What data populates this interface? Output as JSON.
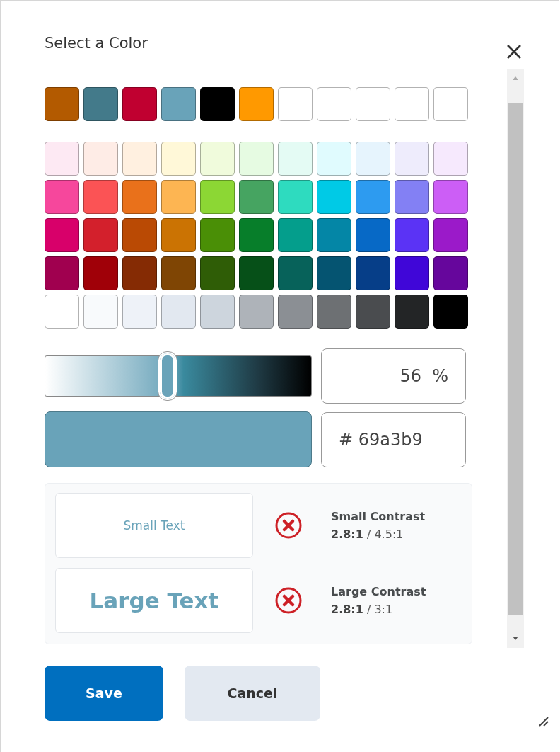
{
  "dialog": {
    "title": "Select a Color"
  },
  "custom_swatches": [
    {
      "color": "#b35a00"
    },
    {
      "color": "#437a8a"
    },
    {
      "color": "#c00030"
    },
    {
      "color": "#69a3b9"
    },
    {
      "color": "#000000"
    },
    {
      "color": "#ff9900"
    },
    {
      "color": "#ffffff"
    },
    {
      "color": "#ffffff"
    },
    {
      "color": "#ffffff"
    },
    {
      "color": "#ffffff"
    },
    {
      "color": "#ffffff"
    }
  ],
  "palette_rows": [
    [
      {
        "color": "#fde9f3"
      },
      {
        "color": "#feece6"
      },
      {
        "color": "#fff0e0"
      },
      {
        "color": "#fff8d8"
      },
      {
        "color": "#f0fbdc"
      },
      {
        "color": "#e6fbe2"
      },
      {
        "color": "#e4fbf4"
      },
      {
        "color": "#e0fbfe"
      },
      {
        "color": "#e6f4fd"
      },
      {
        "color": "#eeecfc"
      },
      {
        "color": "#f6e9fd"
      }
    ],
    [
      {
        "color": "#f6479c"
      },
      {
        "color": "#fb5355"
      },
      {
        "color": "#e9711b"
      },
      {
        "color": "#fdb552"
      },
      {
        "color": "#8cd734"
      },
      {
        "color": "#46a461"
      },
      {
        "color": "#2edbbf"
      },
      {
        "color": "#00cae6"
      },
      {
        "color": "#2d9bf0"
      },
      {
        "color": "#8380f4"
      },
      {
        "color": "#cc5ef6"
      }
    ],
    [
      {
        "color": "#d8006a"
      },
      {
        "color": "#d3202c"
      },
      {
        "color": "#ba4a04"
      },
      {
        "color": "#cb7303"
      },
      {
        "color": "#4a8f06"
      },
      {
        "color": "#077e2a"
      },
      {
        "color": "#049e8c"
      },
      {
        "color": "#0486a6"
      },
      {
        "color": "#0769c6"
      },
      {
        "color": "#5b33f5"
      },
      {
        "color": "#9b1ac9"
      }
    ],
    [
      {
        "color": "#a0004f"
      },
      {
        "color": "#a00008"
      },
      {
        "color": "#852b04"
      },
      {
        "color": "#7f4504"
      },
      {
        "color": "#2f5d06"
      },
      {
        "color": "#065018"
      },
      {
        "color": "#07625a"
      },
      {
        "color": "#055471"
      },
      {
        "color": "#063e88"
      },
      {
        "color": "#4006d8"
      },
      {
        "color": "#66069c"
      }
    ],
    [
      {
        "color": "#ffffff"
      },
      {
        "color": "#f8fafc"
      },
      {
        "color": "#eef2f8"
      },
      {
        "color": "#e2e8f0"
      },
      {
        "color": "#cdd5dd"
      },
      {
        "color": "#aeb3b9"
      },
      {
        "color": "#8b8f94"
      },
      {
        "color": "#6d7073"
      },
      {
        "color": "#4a4c4f"
      },
      {
        "color": "#232526"
      },
      {
        "color": "#000000"
      }
    ]
  ],
  "shade_slider": {
    "level": 0.46
  },
  "percent_field": {
    "value": "56  %"
  },
  "preview_swatch": {
    "color": "#69a3b9"
  },
  "hex_field": {
    "value": "# 69a3b9"
  },
  "contrast_checks": [
    {
      "kind": "small",
      "sample": "Small Text",
      "passed": false,
      "label": "Small Contrast",
      "ratio": "**2.8:1** / 4.5:1"
    },
    {
      "kind": "large",
      "sample": "Large Text",
      "passed": false,
      "label": "Large Contrast",
      "ratio": "**2.8:1** / 3:1"
    }
  ],
  "buttons": [
    {
      "label": "Save",
      "kind": "primary"
    },
    {
      "label": "Cancel",
      "kind": "secondary"
    }
  ]
}
